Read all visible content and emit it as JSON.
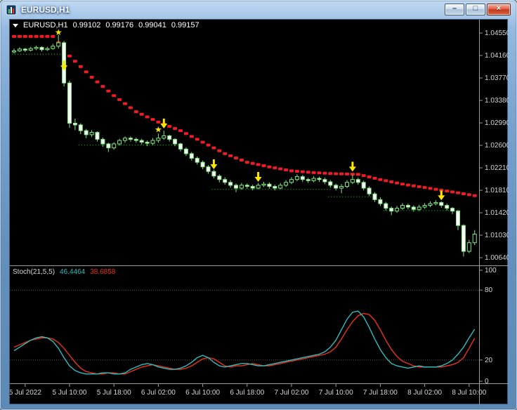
{
  "window": {
    "title": "EURUSD,H1",
    "controls": {
      "minimize_glyph": "–",
      "maximize_glyph": "□",
      "close_glyph": "×"
    }
  },
  "quote": {
    "symbol": "EURUSD,H1",
    "open": "0.99102",
    "high": "0.99176",
    "low": "0.99041",
    "close": "0.99157"
  },
  "stoch": {
    "label": "Stoch(21,5,5)",
    "main_value": "46.4464",
    "signal_value": "38.6858"
  },
  "price_axis": {
    "ticks": [
      "1.04550",
      "1.04160",
      "1.03770",
      "1.03380",
      "1.02990",
      "1.02600",
      "1.02210",
      "1.01810",
      "1.01420",
      "1.01030",
      "1.00640"
    ]
  },
  "time_axis": {
    "labels": [
      "5 Jul 2022",
      "5 Jul 10:00",
      "5 Jul 18:00",
      "6 Jul 02:00",
      "6 Jul 10:00",
      "6 Jul 18:00",
      "7 Jul 02:00",
      "7 Jul 10:00",
      "7 Jul 18:00",
      "8 Jul 02:00",
      "8 Jul 10:00"
    ],
    "bars": [
      2,
      10,
      18,
      26,
      34,
      42,
      50,
      58,
      66,
      74,
      82
    ]
  },
  "chart_data": {
    "type": "candlestick",
    "symbol": "EURUSD",
    "timeframe": "H1",
    "ylim": [
      1.0064,
      1.0455
    ],
    "candles": [
      [
        1.0422,
        1.0428,
        1.0419,
        1.0424
      ],
      [
        1.0424,
        1.043,
        1.0422,
        1.0427
      ],
      [
        1.0427,
        1.0429,
        1.0422,
        1.0425
      ],
      [
        1.0425,
        1.0431,
        1.0423,
        1.0428
      ],
      [
        1.0428,
        1.0433,
        1.0425,
        1.043
      ],
      [
        1.043,
        1.0432,
        1.0423,
        1.0426
      ],
      [
        1.0426,
        1.0431,
        1.0424,
        1.0428
      ],
      [
        1.0428,
        1.0436,
        1.0426,
        1.0432
      ],
      [
        1.0432,
        1.0452,
        1.0428,
        1.0438
      ],
      [
        1.0438,
        1.0441,
        1.0362,
        1.0368
      ],
      [
        1.0368,
        1.0372,
        1.029,
        1.0298
      ],
      [
        1.0298,
        1.0306,
        1.0286,
        1.0295
      ],
      [
        1.0295,
        1.0298,
        1.0279,
        1.0285
      ],
      [
        1.0285,
        1.0288,
        1.0272,
        1.0278
      ],
      [
        1.0278,
        1.0286,
        1.0274,
        1.0282
      ],
      [
        1.0282,
        1.0284,
        1.0266,
        1.027
      ],
      [
        1.027,
        1.0273,
        1.0257,
        1.0262
      ],
      [
        1.0262,
        1.0264,
        1.0248,
        1.0255
      ],
      [
        1.0255,
        1.0265,
        1.0252,
        1.0262
      ],
      [
        1.0262,
        1.0271,
        1.0259,
        1.0268
      ],
      [
        1.0268,
        1.0275,
        1.0264,
        1.0272
      ],
      [
        1.0272,
        1.0275,
        1.0266,
        1.027
      ],
      [
        1.027,
        1.0273,
        1.0264,
        1.0268
      ],
      [
        1.0268,
        1.0271,
        1.0261,
        1.0265
      ],
      [
        1.0265,
        1.0268,
        1.0258,
        1.0263
      ],
      [
        1.0263,
        1.0272,
        1.026,
        1.0268
      ],
      [
        1.0268,
        1.028,
        1.0264,
        1.0272
      ],
      [
        1.0272,
        1.0285,
        1.0269,
        1.0276
      ],
      [
        1.0276,
        1.0278,
        1.0266,
        1.027
      ],
      [
        1.027,
        1.0272,
        1.0258,
        1.0262
      ],
      [
        1.0262,
        1.0264,
        1.0249,
        1.0253
      ],
      [
        1.0253,
        1.0256,
        1.0241,
        1.0245
      ],
      [
        1.0245,
        1.0248,
        1.0233,
        1.0237
      ],
      [
        1.0237,
        1.024,
        1.0226,
        1.023
      ],
      [
        1.023,
        1.0233,
        1.0218,
        1.0222
      ],
      [
        1.0222,
        1.0225,
        1.021,
        1.0214
      ],
      [
        1.0214,
        1.0217,
        1.0202,
        1.0206
      ],
      [
        1.0206,
        1.0209,
        1.0195,
        1.02
      ],
      [
        1.02,
        1.0204,
        1.0191,
        1.0195
      ],
      [
        1.0195,
        1.0199,
        1.0186,
        1.019
      ],
      [
        1.019,
        1.0193,
        1.0178,
        1.0185
      ],
      [
        1.0185,
        1.0194,
        1.0182,
        1.019
      ],
      [
        1.019,
        1.0193,
        1.0184,
        1.0188
      ],
      [
        1.0188,
        1.0191,
        1.0181,
        1.0185
      ],
      [
        1.0185,
        1.0194,
        1.0183,
        1.019
      ],
      [
        1.019,
        1.0196,
        1.0187,
        1.0192
      ],
      [
        1.0192,
        1.0195,
        1.0184,
        1.0188
      ],
      [
        1.0188,
        1.0191,
        1.0181,
        1.0185
      ],
      [
        1.0185,
        1.0194,
        1.0183,
        1.019
      ],
      [
        1.019,
        1.0199,
        1.0187,
        1.0195
      ],
      [
        1.0195,
        1.0204,
        1.0192,
        1.02
      ],
      [
        1.02,
        1.0209,
        1.0197,
        1.0205
      ],
      [
        1.0205,
        1.0208,
        1.0196,
        1.02
      ],
      [
        1.02,
        1.0203,
        1.0194,
        1.0198
      ],
      [
        1.0198,
        1.0206,
        1.0195,
        1.0202
      ],
      [
        1.0202,
        1.0205,
        1.0196,
        1.02
      ],
      [
        1.02,
        1.0203,
        1.0192,
        1.0196
      ],
      [
        1.0196,
        1.0199,
        1.0186,
        1.019
      ],
      [
        1.019,
        1.0193,
        1.0181,
        1.0185
      ],
      [
        1.0185,
        1.0192,
        1.0176,
        1.0188
      ],
      [
        1.0188,
        1.0199,
        1.0185,
        1.0195
      ],
      [
        1.0195,
        1.0208,
        1.0192,
        1.02
      ],
      [
        1.02,
        1.0203,
        1.0191,
        1.0195
      ],
      [
        1.0195,
        1.0198,
        1.0181,
        1.0185
      ],
      [
        1.0185,
        1.0188,
        1.0171,
        1.0175
      ],
      [
        1.0175,
        1.0178,
        1.0161,
        1.0165
      ],
      [
        1.0165,
        1.0169,
        1.0154,
        1.0158
      ],
      [
        1.0158,
        1.0161,
        1.0146,
        1.015
      ],
      [
        1.015,
        1.0153,
        1.0138,
        1.0145
      ],
      [
        1.0145,
        1.0154,
        1.0142,
        1.015
      ],
      [
        1.015,
        1.0159,
        1.0147,
        1.0155
      ],
      [
        1.0155,
        1.0158,
        1.0148,
        1.0152
      ],
      [
        1.0152,
        1.0155,
        1.0144,
        1.0148
      ],
      [
        1.0148,
        1.0156,
        1.0145,
        1.0152
      ],
      [
        1.0152,
        1.0159,
        1.0149,
        1.0155
      ],
      [
        1.0155,
        1.0162,
        1.0152,
        1.0158
      ],
      [
        1.0158,
        1.0164,
        1.0155,
        1.016
      ],
      [
        1.016,
        1.0162,
        1.0151,
        1.0155
      ],
      [
        1.0155,
        1.0158,
        1.0146,
        1.015
      ],
      [
        1.015,
        1.0152,
        1.014,
        1.0145
      ],
      [
        1.0145,
        1.0147,
        1.0112,
        1.012
      ],
      [
        1.012,
        1.0122,
        1.0066,
        1.0075
      ],
      [
        1.0075,
        1.0095,
        1.0072,
        1.009
      ],
      [
        1.009,
        1.0112,
        1.0086,
        1.0105
      ]
    ],
    "trend": [
      1.0449,
      1.0449,
      1.0449,
      1.0449,
      1.0449,
      1.0449,
      1.0449,
      1.0449,
      1.0438,
      1.0426,
      1.0415,
      1.04058,
      1.03965,
      1.03873,
      1.0378,
      1.037,
      1.0362,
      1.0354,
      1.0346,
      1.0339,
      1.0332,
      1.0325,
      1.0318,
      1.03135,
      1.0309,
      1.03045,
      1.03,
      1.02963,
      1.02925,
      1.02888,
      1.0285,
      1.028,
      1.0275,
      1.027,
      1.0265,
      1.026,
      1.0255,
      1.025,
      1.0245,
      1.02413,
      1.02375,
      1.02338,
      1.023,
      1.0228,
      1.0226,
      1.0224,
      1.0222,
      1.02203,
      1.02185,
      1.02168,
      1.0215,
      1.02143,
      1.02135,
      1.02128,
      1.0212,
      1.02115,
      1.0211,
      1.02105,
      1.021,
      1.02098,
      1.02095,
      1.02093,
      1.0209,
      1.02068,
      1.02045,
      1.02023,
      1.02,
      1.0198,
      1.0196,
      1.0194,
      1.0192,
      1.01905,
      1.0189,
      1.01875,
      1.0186,
      1.01845,
      1.0183,
      1.01815,
      1.018,
      1.01784,
      1.01768,
      1.01752,
      1.01736,
      1.0172
    ],
    "supports": [
      {
        "from": 0,
        "to": 9,
        "price": 1.0418
      },
      {
        "from": 12,
        "to": 30,
        "price": 1.026
      },
      {
        "from": 36,
        "to": 57,
        "price": 1.0183
      },
      {
        "from": 57,
        "to": 64,
        "price": 1.017
      },
      {
        "from": 67,
        "to": 80,
        "price": 1.0146
      }
    ],
    "markers": {
      "star_glyph": "★",
      "stars": [
        {
          "bar": 8,
          "price": 1.0456
        },
        {
          "bar": 26,
          "price": 1.0287
        }
      ],
      "arrows": [
        {
          "bar": 9,
          "price": 1.0396
        },
        {
          "bar": 27,
          "price": 1.0295
        },
        {
          "bar": 36,
          "price": 1.0224
        },
        {
          "bar": 44,
          "price": 1.0202
        },
        {
          "bar": 61,
          "price": 1.022
        },
        {
          "bar": 77,
          "price": 1.017
        }
      ]
    },
    "stoch": {
      "levels": [
        80,
        20
      ],
      "scale": [
        "100",
        "80",
        "20",
        "0"
      ],
      "k": [
        28,
        31,
        34,
        37,
        39,
        40,
        39,
        36,
        30,
        22,
        15,
        11,
        9,
        8,
        8,
        8,
        9,
        9,
        8,
        8,
        9,
        12,
        14,
        16,
        17,
        16,
        14,
        13,
        12,
        12,
        13,
        15,
        18,
        22,
        24,
        22,
        18,
        15,
        14,
        15,
        16,
        17,
        17,
        16,
        15,
        15,
        16,
        17,
        18,
        19,
        20,
        21,
        22,
        23,
        24,
        25,
        27,
        31,
        37,
        46,
        55,
        61,
        62,
        57,
        48,
        38,
        29,
        22,
        17,
        15,
        14,
        13,
        14,
        15,
        14,
        14,
        14,
        15,
        17,
        20,
        25,
        31,
        39,
        46.4
      ],
      "d": [
        31,
        33,
        35,
        37,
        38,
        39,
        39,
        38,
        35,
        30,
        24,
        18,
        13,
        10,
        9,
        8,
        8,
        9,
        9,
        8,
        8,
        10,
        12,
        14,
        15,
        16,
        15,
        14,
        13,
        12,
        12,
        13,
        15,
        18,
        21,
        22,
        21,
        18,
        15,
        14,
        15,
        15,
        16,
        17,
        16,
        15,
        15,
        16,
        17,
        18,
        19,
        20,
        21,
        22,
        23,
        24,
        25,
        27,
        31,
        38,
        46,
        53,
        58,
        60,
        59,
        54,
        46,
        37,
        29,
        23,
        19,
        17,
        15,
        14,
        14,
        14,
        14,
        14,
        15,
        16,
        18,
        22,
        30,
        38.7
      ]
    },
    "colors": {
      "background": "#000000",
      "outline": "#7fe97f",
      "bull": "#000000",
      "bear": "#ffffff",
      "trend": "#ee1c24",
      "support": "#00c000",
      "arrow": "#ffe400",
      "stoch_main": "#2fbdbd",
      "stoch_signal": "#e8341c",
      "grid": "#5a5a5a",
      "frame": "#9c9c9c",
      "text": "#d6d6d6"
    }
  }
}
